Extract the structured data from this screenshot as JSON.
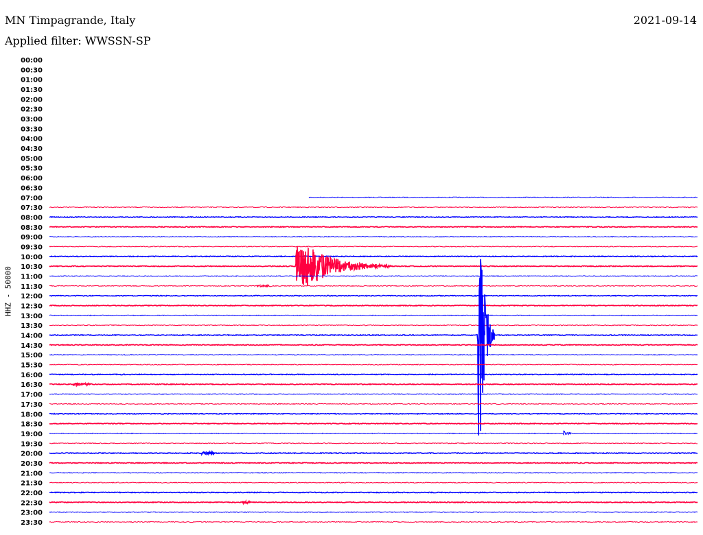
{
  "header": {
    "station": "MN Timpagrande, Italy",
    "filter": "Applied filter: WWSSN-SP",
    "date": "2021-09-14"
  },
  "chart_data": {
    "type": "line",
    "title": "MN Timpagrande, Italy",
    "subtitle": "Applied filter: WWSSN-SP",
    "ylabel": "HHZ - 50000",
    "minutes_per_row": 30,
    "row_labels": [
      "00:00",
      "00:30",
      "01:00",
      "01:30",
      "02:00",
      "02:30",
      "03:00",
      "03:30",
      "04:00",
      "04:30",
      "05:00",
      "05:30",
      "06:00",
      "06:30",
      "07:00",
      "07:30",
      "08:00",
      "08:30",
      "09:00",
      "09:30",
      "10:00",
      "10:30",
      "11:00",
      "11:30",
      "12:00",
      "12:30",
      "13:00",
      "13:30",
      "14:00",
      "14:30",
      "15:00",
      "15:30",
      "16:00",
      "16:30",
      "17:00",
      "17:30",
      "18:00",
      "18:30",
      "19:00",
      "19:30",
      "20:00",
      "20:30",
      "21:00",
      "21:30",
      "22:00",
      "22:30",
      "23:00",
      "23:30"
    ],
    "data_start": "07:12",
    "colors": {
      "even": "#0000ff",
      "odd": "#ff0040"
    },
    "events": [
      {
        "row": "10:30",
        "start_min": 11.4,
        "end_min": 15.8,
        "peak_min": 12.0,
        "amplitude": 1.0
      },
      {
        "row": "14:00",
        "start_min": 19.8,
        "end_min": 20.6,
        "peak_min": 19.9,
        "amplitude": 6.0
      },
      {
        "row": "19:00",
        "start_min": 23.8,
        "end_min": 24.4,
        "peak_min": 23.9,
        "amplitude": 0.15
      },
      {
        "row": "11:30",
        "start_min": 9.6,
        "end_min": 10.8,
        "peak_min": 10.0,
        "amplitude": 0.08
      },
      {
        "row": "16:30",
        "start_min": 1.1,
        "end_min": 3.2,
        "peak_min": 1.2,
        "amplitude": 0.08
      },
      {
        "row": "20:00",
        "start_min": 7.0,
        "end_min": 8.2,
        "peak_min": 7.5,
        "amplitude": 0.06
      },
      {
        "row": "22:30",
        "start_min": 8.9,
        "end_min": 9.7,
        "peak_min": 9.2,
        "amplitude": 0.06
      }
    ]
  }
}
